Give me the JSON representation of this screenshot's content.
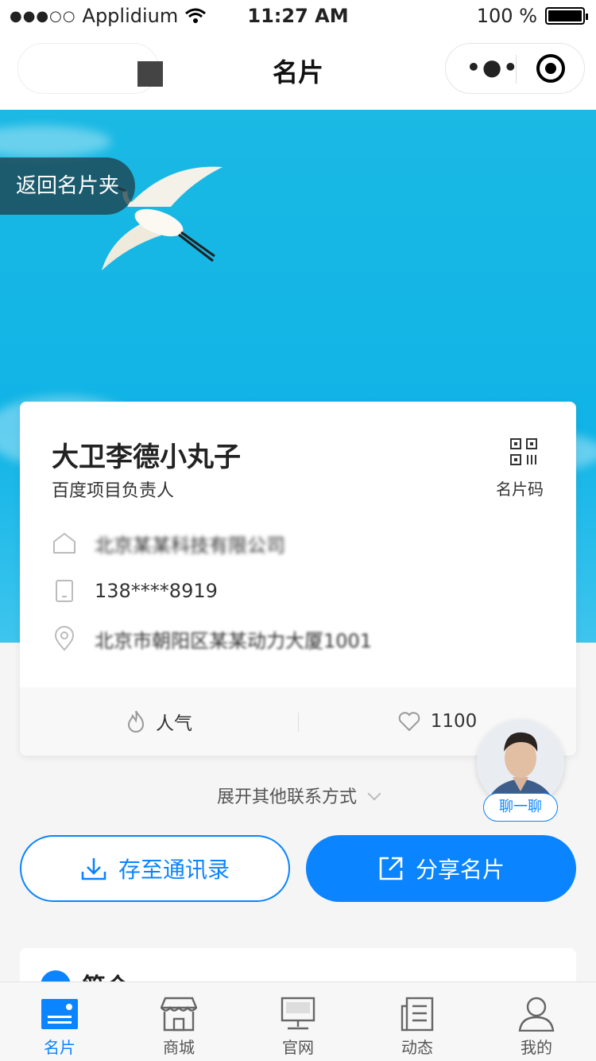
{
  "status_bar": {
    "carrier": "Applidium",
    "time": "11:27 AM",
    "battery": "100 %"
  },
  "navbar": {
    "title": "名片"
  },
  "hero": {
    "back_label": "返回名片夹"
  },
  "card": {
    "name": "大卫李德小丸子",
    "role": "百度项目负责人",
    "qr_label": "名片码",
    "company": "北京某某科技有限公司",
    "phone": "138****8919",
    "address": "北京市朝阳区某某动力大厦1001",
    "popularity_label": "人气",
    "likes": "1100"
  },
  "chat_label": "聊一聊",
  "expand_label": "展开其他联系方式",
  "buttons": {
    "save": "存至通讯录",
    "share": "分享名片"
  },
  "intro": {
    "title": "简介"
  },
  "tabs": [
    {
      "label": "名片",
      "icon": "card-icon",
      "active": true
    },
    {
      "label": "商城",
      "icon": "shop-icon",
      "active": false
    },
    {
      "label": "官网",
      "icon": "monitor-icon",
      "active": false
    },
    {
      "label": "动态",
      "icon": "news-icon",
      "active": false
    },
    {
      "label": "我的",
      "icon": "user-icon",
      "active": false
    }
  ],
  "colors": {
    "accent": "#0a84ff",
    "hero_sky": "#10b4e6"
  }
}
